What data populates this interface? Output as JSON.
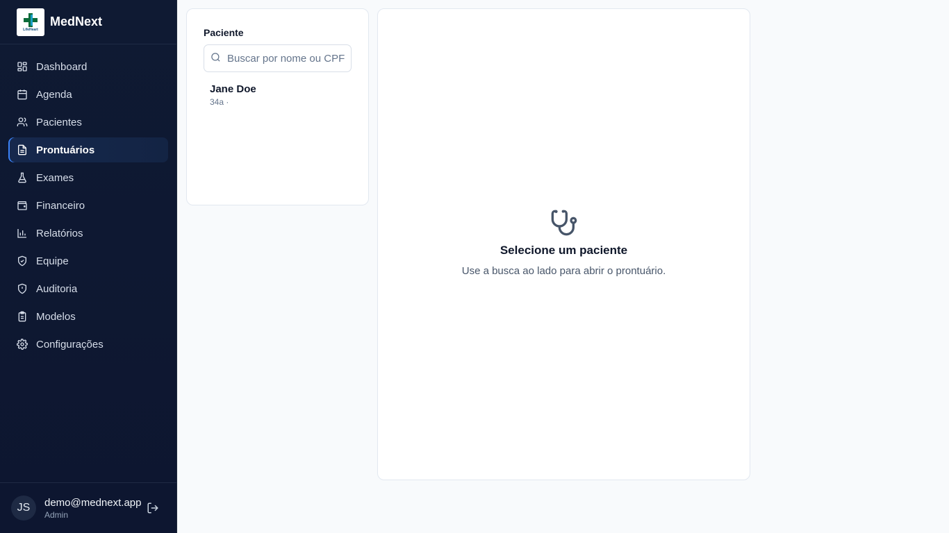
{
  "brand": {
    "name": "MedNext",
    "logo_text": "LifeHeart"
  },
  "sidebar": {
    "items": [
      {
        "label": "Dashboard",
        "icon": "dashboard-icon"
      },
      {
        "label": "Agenda",
        "icon": "calendar-icon"
      },
      {
        "label": "Pacientes",
        "icon": "users-icon"
      },
      {
        "label": "Prontuários",
        "icon": "file-text-icon",
        "active": true
      },
      {
        "label": "Exames",
        "icon": "flask-icon"
      },
      {
        "label": "Financeiro",
        "icon": "wallet-icon"
      },
      {
        "label": "Relatórios",
        "icon": "bar-chart-icon"
      },
      {
        "label": "Equipe",
        "icon": "shield-check-icon"
      },
      {
        "label": "Auditoria",
        "icon": "shield-alert-icon"
      },
      {
        "label": "Modelos",
        "icon": "clipboard-icon"
      },
      {
        "label": "Configurações",
        "icon": "gear-icon"
      }
    ]
  },
  "user": {
    "initials": "JS",
    "email": "demo@mednext.app",
    "role": "Admin"
  },
  "patient_panel": {
    "title": "Paciente",
    "search_placeholder": "Buscar por nome ou CPF",
    "patients": [
      {
        "name": "Jane Doe",
        "meta": "34a ·"
      }
    ]
  },
  "empty_state": {
    "title": "Selecione um paciente",
    "subtitle": "Use a busca ao lado para abrir o prontuário."
  },
  "colors": {
    "sidebar_bg": "#0f1a33",
    "accent": "#3b82f6",
    "page_bg": "#f8fafc"
  }
}
